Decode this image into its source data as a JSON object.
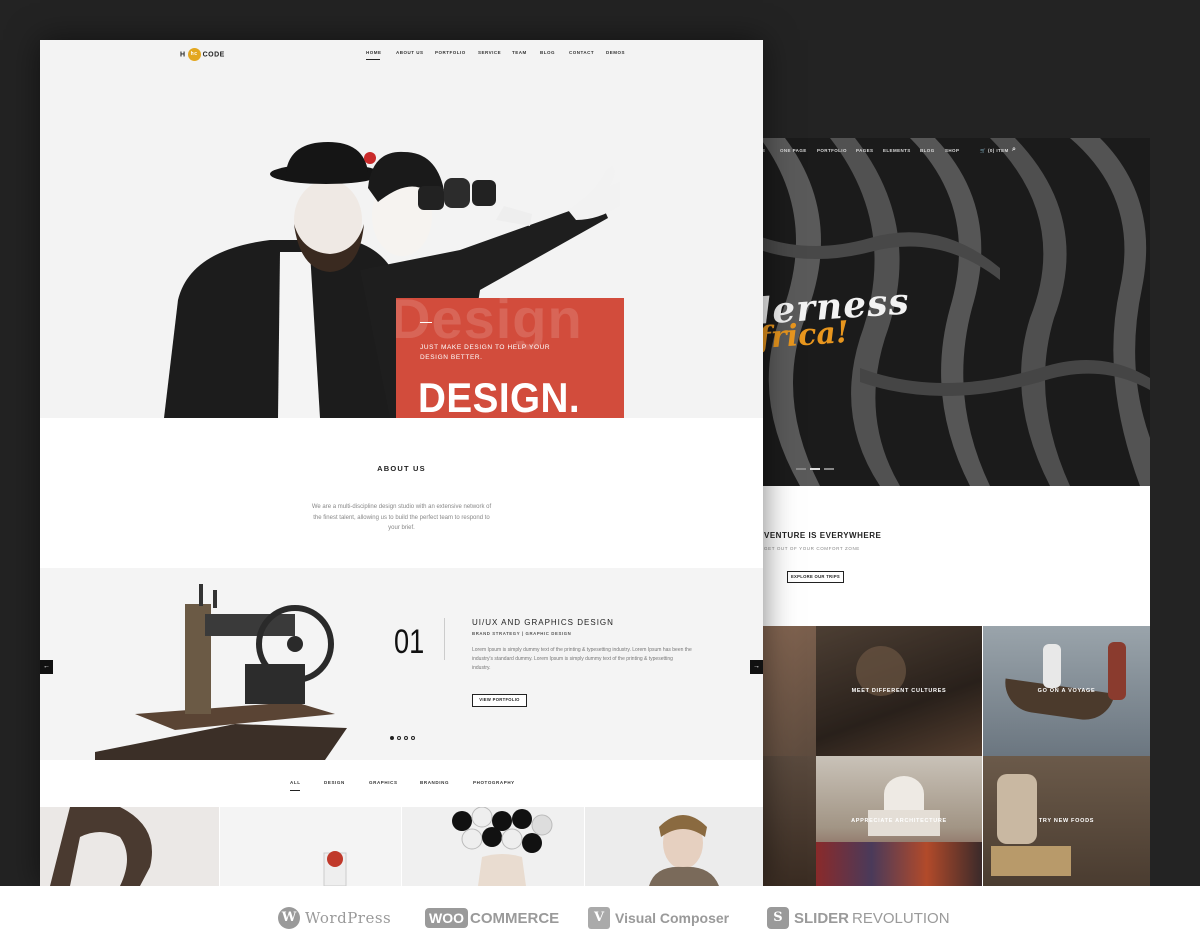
{
  "front_page": {
    "logo": {
      "left": "H",
      "mid": "hc",
      "right": "CODE"
    },
    "nav": [
      "HOME",
      "ABOUT US",
      "PORTFOLIO",
      "SERVICE",
      "TEAM",
      "BLOG",
      "CONTACT",
      "DEMOS"
    ],
    "hero": {
      "watermark": "Design",
      "tagline": "JUST MAKE DESIGN TO HELP YOUR DESIGN BETTER.",
      "headline": "DESIGN."
    },
    "about": {
      "title": "ABOUT US",
      "text": "We are a multi-discipline design studio with an extensive network of the finest talent, allowing us to build the perfect team to respond to your brief."
    },
    "slider": {
      "number": "01",
      "title": "UI/UX AND GRAPHICS DESIGN",
      "subtitle": "BRAND STRATEGY | GRAPHIC DESIGN",
      "text": "Lorem Ipsum is simply dummy text of the printing & typesetting industry. Lorem Ipsum has been the industry's standard dummy. Lorem Ipsum is simply dummy text of the printing & typesetting industry.",
      "button": "VIEW PORTFOLIO",
      "prev_icon": "arrow-left-icon",
      "next_icon": "arrow-right-icon",
      "prev_glyph": "←",
      "next_glyph": "→"
    },
    "filters": [
      "ALL",
      "DESIGN",
      "GRAPHICS",
      "BRANDING",
      "PHOTOGRAPHY"
    ],
    "accent_color": "#d24c3c",
    "logo_color": "#e3a71f"
  },
  "back_page": {
    "nav": [
      "E",
      "ONE PAGE",
      "PORTFOLIO",
      "PAGES",
      "ELEMENTS",
      "BLOG",
      "SHOP",
      "(0) ITEM"
    ],
    "cart_glyph": "🛒",
    "search_glyph": "⌕",
    "hero": {
      "line1": "derness",
      "line2": "frica!"
    },
    "adventure": {
      "title": "VENTURE IS EVERYWHERE",
      "subtitle": "GET OUT OF YOUR COMFORT ZONE",
      "button": "EXPLORE OUR TRIPS"
    },
    "tiles": [
      "MEET DIFFERENT CULTURES",
      "GO ON A VOYAGE",
      "APPRECIATE ARCHITECTURE",
      "TRY NEW FOODS"
    ]
  },
  "brands": [
    {
      "name": "WordPress",
      "icon": "wordpress-icon",
      "glyph": "W"
    },
    {
      "name": "COMMERCE",
      "prefix": "WOO",
      "icon": "woocommerce-icon"
    },
    {
      "name": "Visual Composer",
      "icon": "visual-composer-icon",
      "glyph": "V"
    },
    {
      "name": "SLIDER",
      "suffix": "REVOLUTION",
      "icon": "slider-revolution-icon",
      "glyph": "S"
    }
  ]
}
